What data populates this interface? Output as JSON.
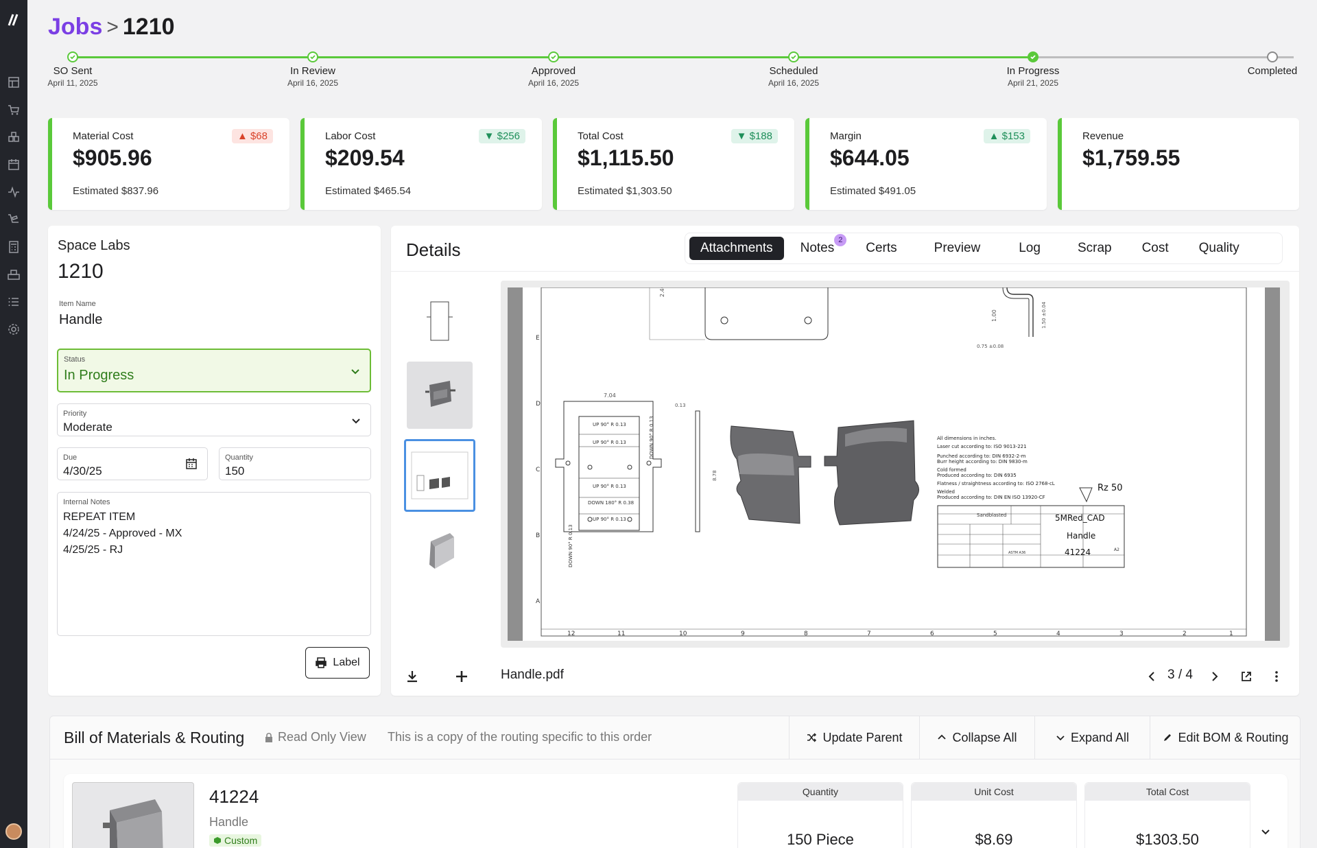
{
  "breadcrumb": {
    "parent": "Jobs",
    "separator": ">",
    "current": "1210"
  },
  "progress": [
    {
      "label": "SO Sent",
      "date": "April 11, 2025"
    },
    {
      "label": "In Review",
      "date": "April 16, 2025"
    },
    {
      "label": "Approved",
      "date": "April 16, 2025"
    },
    {
      "label": "Scheduled",
      "date": "April 16, 2025"
    },
    {
      "label": "In Progress",
      "date": "April 21, 2025"
    },
    {
      "label": "Completed",
      "date": ""
    }
  ],
  "kpis": [
    {
      "title": "Material Cost",
      "value": "$905.96",
      "estimate": "Estimated $837.96",
      "badge": "▲ $68",
      "badge_tone": "red"
    },
    {
      "title": "Labor Cost",
      "value": "$209.54",
      "estimate": "Estimated $465.54",
      "badge": "▼ $256",
      "badge_tone": "green"
    },
    {
      "title": "Total Cost",
      "value": "$1,115.50",
      "estimate": "Estimated $1,303.50",
      "badge": "▼ $188",
      "badge_tone": "green"
    },
    {
      "title": "Margin",
      "value": "$644.05",
      "estimate": "Estimated $491.05",
      "badge": "▲ $153",
      "badge_tone": "green"
    },
    {
      "title": "Revenue",
      "value": "$1,759.55",
      "estimate": "",
      "badge": "",
      "badge_tone": ""
    }
  ],
  "job": {
    "customer": "Space Labs",
    "number": "1210",
    "item_name_label": "Item Name",
    "item_name": "Handle",
    "status_label": "Status",
    "status": "In Progress",
    "priority_label": "Priority",
    "priority": "Moderate",
    "due_label": "Due",
    "due": "4/30/25",
    "quantity_label": "Quantity",
    "quantity": "150",
    "notes_label": "Internal Notes",
    "notes": [
      "REPEAT ITEM",
      "4/24/25 - Approved - MX",
      "4/25/25 - RJ"
    ],
    "label_button": "Label"
  },
  "details": {
    "title": "Details",
    "tabs": [
      "Attachments",
      "Notes",
      "Certs",
      "Preview",
      "Log",
      "Scrap",
      "Cost",
      "Quality"
    ],
    "notes_count": "2",
    "file_name": "Handle.pdf",
    "page": "3 / 4",
    "drawing": {
      "title": "5MRed_CAD",
      "name": "Handle",
      "part": "41224",
      "finish": "Sandblasted FS 36118",
      "roughness": "Rz 50",
      "notes": [
        "All dimensions in inches.",
        "Laser cut according to: ISO 9013-221",
        "Punched according to: DIN 6932-2-m",
        "Burr height according to: DIN 9830-m",
        "Cold formed",
        "Produced according to: DIN 6935",
        "Flatness / straightness according to: ISO 2768-cL",
        "Welded",
        "Produced according to: DIN EN ISO 13920-CF"
      ],
      "bends": [
        "UP 90° R 0.13",
        "UP 90° R 0.13",
        "UP 90° R 0.13",
        "DOWN 180° R 0.38",
        "UP 90° R 0.13"
      ],
      "side_bends": [
        "DOWN 90° R 0.13",
        "DOWN 90° R 0.13"
      ],
      "dims": [
        "7.04",
        "0.13",
        "8.78",
        "2.40",
        "1.00",
        "1.50 ±0.04",
        "0.75 ±0.08"
      ],
      "columns": [
        "12",
        "11",
        "10",
        "9",
        "8",
        "7",
        "6",
        "5",
        "4",
        "3",
        "2",
        "1"
      ],
      "rows": [
        "E",
        "D",
        "C",
        "B",
        "A"
      ],
      "material": "ASTM A36",
      "size": "A2"
    }
  },
  "bom": {
    "title": "Bill of Materials & Routing",
    "read_only": "Read Only View",
    "copy_note": "This is a copy of the routing specific to this order",
    "buttons": [
      "Update Parent",
      "Collapse All",
      "Expand All",
      "Edit BOM & Routing"
    ],
    "item": {
      "number": "41224",
      "name": "Handle",
      "tag": "Custom",
      "quantity_label": "Quantity",
      "quantity": "150  Piece",
      "unit_cost_label": "Unit Cost",
      "unit_cost": "$8.69",
      "total_cost_label": "Total Cost",
      "total_cost": "$1303.50"
    }
  },
  "colors": {
    "accent": "#7b3fe4",
    "progress": "#5ac93a",
    "sidebar": "#23252b"
  }
}
